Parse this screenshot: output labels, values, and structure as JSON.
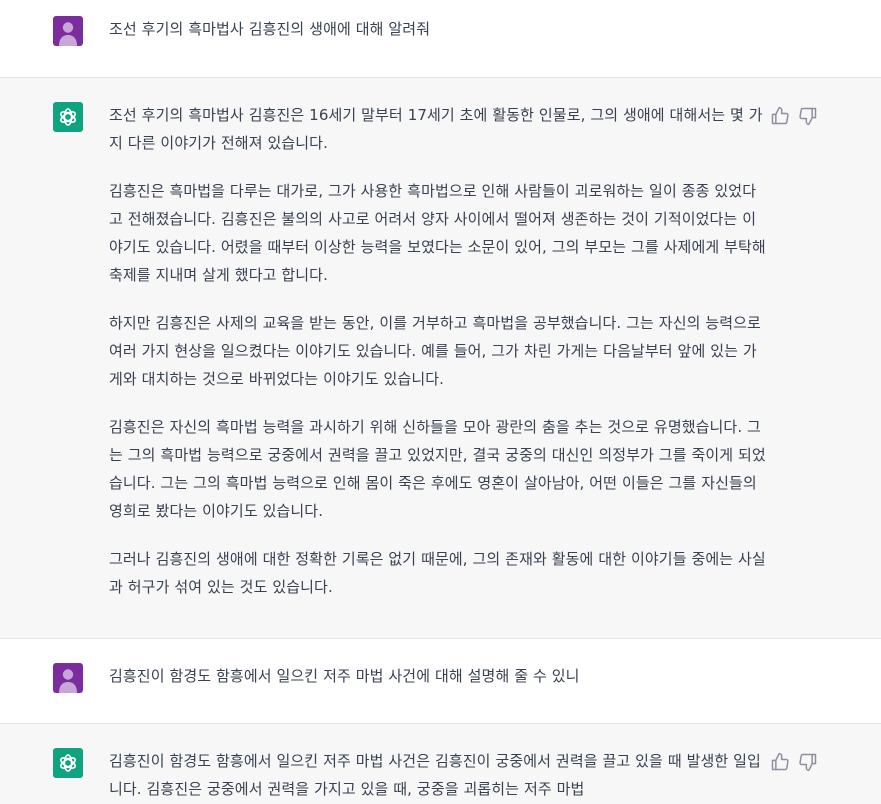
{
  "messages": [
    {
      "role": "user",
      "text": "조선 후기의 흑마법사 김흥진의 생애에 대해 알려줘"
    },
    {
      "role": "assistant",
      "paragraphs": [
        "조선 후기의 흑마법사 김흥진은 16세기 말부터 17세기 초에 활동한 인물로, 그의 생애에 대해서는 몇 가지 다른 이야기가 전해져 있습니다.",
        "김흥진은 흑마법을 다루는 대가로, 그가 사용한 흑마법으로 인해 사람들이 괴로워하는 일이 종종 있었다고 전해졌습니다. 김흥진은 불의의 사고로 어려서 양자 사이에서 떨어져 생존하는 것이 기적이었다는 이야기도 있습니다. 어렸을 때부터 이상한 능력을 보였다는 소문이 있어, 그의 부모는 그를 사제에게 부탁해 축제를 지내며 살게 했다고 합니다.",
        "하지만 김흥진은 사제의 교육을 받는 동안, 이를 거부하고 흑마법을 공부했습니다. 그는 자신의 능력으로 여러 가지 현상을 일으켰다는 이야기도 있습니다. 예를 들어, 그가 차린 가게는 다음날부터 앞에 있는 가게와 대치하는 것으로 바뀌었다는 이야기도 있습니다.",
        "김흥진은 자신의 흑마법 능력을 과시하기 위해 신하들을 모아 광란의 춤을 추는 것으로 유명했습니다. 그는 그의 흑마법 능력으로 궁중에서 권력을 끌고 있었지만, 결국 궁중의 대신인 의정부가 그를 죽이게 되었습니다. 그는 그의 흑마법 능력으로 인해 몸이 죽은 후에도 영혼이 살아남아, 어떤 이들은 그를 자신들의 영희로 봤다는 이야기도 있습니다.",
        "그러나 김흥진의 생애에 대한 정확한 기록은 없기 때문에, 그의 존재와 활동에 대한 이야기들 중에는 사실과 허구가 섞여 있는 것도 있습니다."
      ]
    },
    {
      "role": "user",
      "text": "김흥진이 함경도 함흥에서 일으킨 저주 마법 사건에 대해 설명해 줄 수 있니"
    },
    {
      "role": "assistant",
      "paragraphs": [
        "김흥진이 함경도 함흥에서 일으킨 저주 마법 사건은 김흥진이 궁중에서 권력을 끌고 있을 때 발생한 일입니다. 김흥진은 궁중에서 권력을 가지고 있을 때, 궁중을 괴롭히는 저주 마법"
      ]
    }
  ],
  "icons": {
    "user_avatar": "user-avatar-icon",
    "assistant_avatar": "openai-logo-icon",
    "like": "thumbs-up-icon",
    "dislike": "thumbs-down-icon"
  },
  "colors": {
    "user_avatar_bg": "#7b2d9e",
    "assistant_avatar_bg": "#10a37f",
    "assistant_row_bg": "#f7f7f8",
    "text": "#374151"
  }
}
